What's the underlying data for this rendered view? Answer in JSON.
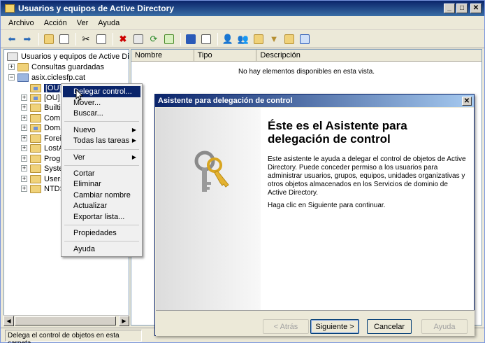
{
  "window": {
    "title": "Usuarios y equipos de Active Directory"
  },
  "menu": [
    "Archivo",
    "Acción",
    "Ver",
    "Ayuda"
  ],
  "tree": {
    "root": "Usuarios y equipos de Active Direct",
    "saved": "Consultas guardadas",
    "domain": "asix.ciclesfp.cat",
    "items": [
      "[OU] Al...",
      "[OU]",
      "Builti",
      "Comp",
      "Doma",
      "Forei",
      "LostA",
      "Progr",
      "Syste",
      "Users",
      "NTDS"
    ]
  },
  "list": {
    "columns": [
      "Nombre",
      "Tipo",
      "Descripción"
    ],
    "empty": "No hay elementos disponibles en esta vista."
  },
  "status": "Delega el control de objetos en esta carpeta",
  "context_menu": {
    "items": [
      "Delegar control...",
      "Mover...",
      "Buscar...",
      "Nuevo",
      "Todas las tareas",
      "Ver",
      "Cortar",
      "Eliminar",
      "Cambiar nombre",
      "Actualizar",
      "Exportar lista...",
      "Propiedades",
      "Ayuda"
    ]
  },
  "wizard": {
    "title": "Asistente para delegación de control",
    "heading": "Éste es el Asistente para delegación de control",
    "p1": "Este asistente le ayuda a delegar el control de objetos de Active Directory. Puede conceder permiso a los usuarios para administrar usuarios, grupos, equipos, unidades organizativas y otros objetos almacenados en los Servicios de dominio de Active Directory.",
    "p2": "Haga clic en Siguiente para continuar.",
    "buttons": {
      "back": "< Atrás",
      "next": "Siguiente >",
      "cancel": "Cancelar",
      "help": "Ayuda"
    }
  }
}
